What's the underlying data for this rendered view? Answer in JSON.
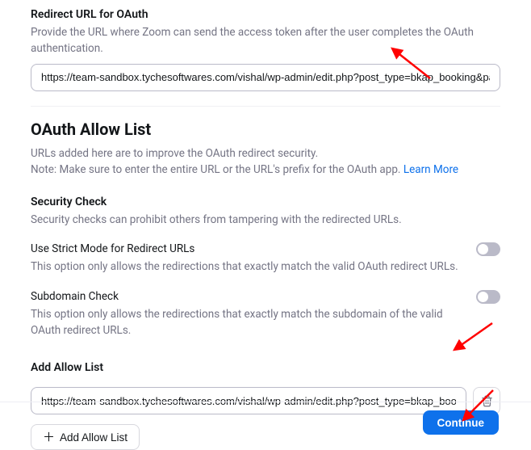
{
  "redirect": {
    "label": "Redirect URL for OAuth",
    "help": "Provide the URL where Zoom can send the access token after the user completes the OAuth authentication.",
    "value": "https://team-sandbox.tychesoftwares.com/vishal/wp-admin/edit.php?post_type=bkap_booking&page=w"
  },
  "allowlist": {
    "title": "OAuth Allow List",
    "help_line1": "URLs added here are to improve the OAuth redirect security.",
    "help_line2_prefix": "Note: Make sure to enter the entire URL or the URL's prefix for the OAuth app. ",
    "learn_more": "Learn More"
  },
  "security_check": {
    "label": "Security Check",
    "desc": "Security checks can prohibit others from tampering with the redirected URLs."
  },
  "strict_mode": {
    "label": "Use Strict Mode for Redirect URLs",
    "desc": "This option only allows the redirections that exactly match the valid OAuth redirect URLs."
  },
  "subdomain_check": {
    "label": "Subdomain Check",
    "desc": "This option only allows the redirections that exactly match the subdomain of the valid OAuth redirect URLs."
  },
  "add_allow": {
    "label": "Add Allow List",
    "value": "https://team-sandbox.tychesoftwares.com/vishal/wp-admin/edit.php?post_type=bkap_booking&pa",
    "button": "Add Allow List"
  },
  "footer": {
    "continue": "Continue"
  }
}
